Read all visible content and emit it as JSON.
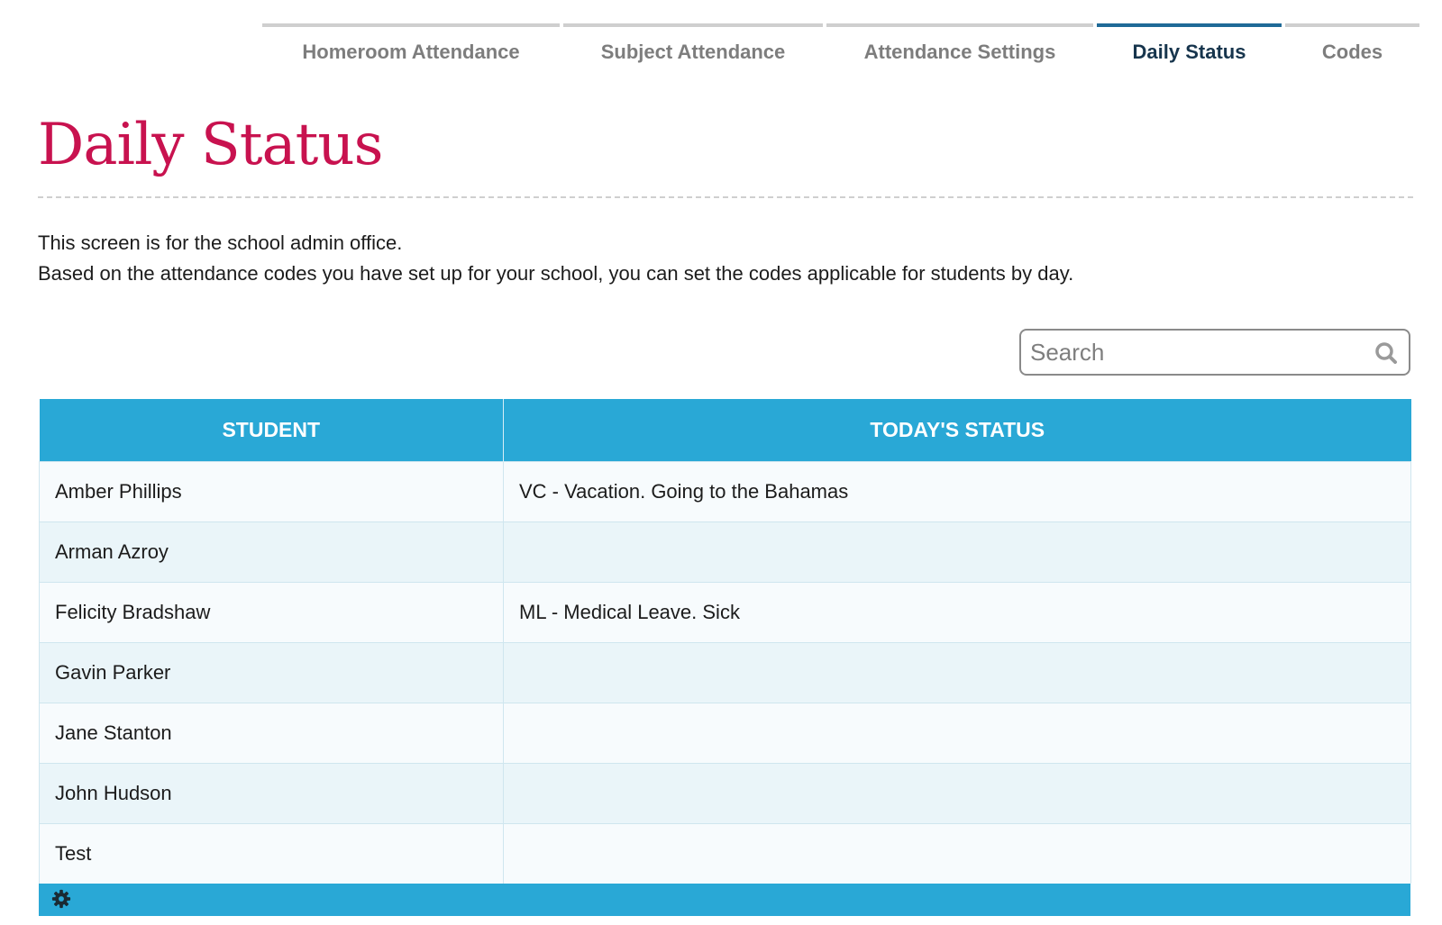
{
  "tabs": [
    {
      "label": "Homeroom Attendance",
      "active": false
    },
    {
      "label": "Subject Attendance",
      "active": false
    },
    {
      "label": "Attendance Settings",
      "active": false
    },
    {
      "label": "Daily Status",
      "active": true
    },
    {
      "label": "Codes",
      "active": false
    }
  ],
  "page": {
    "title": "Daily Status",
    "description_line1": "This screen is for the school admin office.",
    "description_line2": "Based on the attendance codes you have set up for your school, you can set the codes applicable for students by day."
  },
  "search": {
    "placeholder": "Search",
    "value": ""
  },
  "table": {
    "columns": [
      "STUDENT",
      "TODAY'S STATUS"
    ],
    "rows": [
      {
        "student": "Amber Phillips",
        "status": "VC - Vacation. Going to the Bahamas"
      },
      {
        "student": "Arman Azroy",
        "status": ""
      },
      {
        "student": "Felicity Bradshaw",
        "status": "ML - Medical Leave. Sick"
      },
      {
        "student": "Gavin Parker",
        "status": ""
      },
      {
        "student": "Jane Stanton",
        "status": ""
      },
      {
        "student": "John Hudson",
        "status": ""
      },
      {
        "student": "Test",
        "status": ""
      }
    ]
  },
  "icons": {
    "search": "search-icon",
    "footer": "gear-icon"
  },
  "colors": {
    "title": "#c8124f",
    "header_bg": "#29a8d6",
    "active_tab": "#1f6a97"
  }
}
